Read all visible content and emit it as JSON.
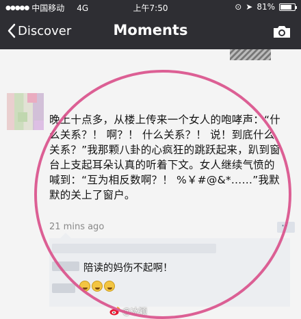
{
  "statusbar": {
    "carrier": "中国移动",
    "network": "4G",
    "time": "上午7:50",
    "battery_text": "81%",
    "battery_level": 0.81
  },
  "navbar": {
    "back_label": "Discover",
    "title": "Moments"
  },
  "post": {
    "text": "晚上十点多，从楼上传来一个女人的咆哮声：“什么关系？！ 啊？！ 什么关系？！ 说！到底什么关系？”我那颗八卦的心疯狂的跳跃起来，趴到窗台上支起耳朵认真的听着下文。女人继续气愤的喊到：“互为相反数啊？！ %￥#@&*……”我默默的关上了窗户。",
    "time": "21 mins ago"
  },
  "comments": [
    {
      "text": "陪读的妈伤不起啊！"
    },
    {
      "emoji_count": 3
    }
  ],
  "watermark": "@冰颖",
  "colors": {
    "bar_bg": "#2e2e33",
    "highlight_circle": "#d94f8a"
  }
}
